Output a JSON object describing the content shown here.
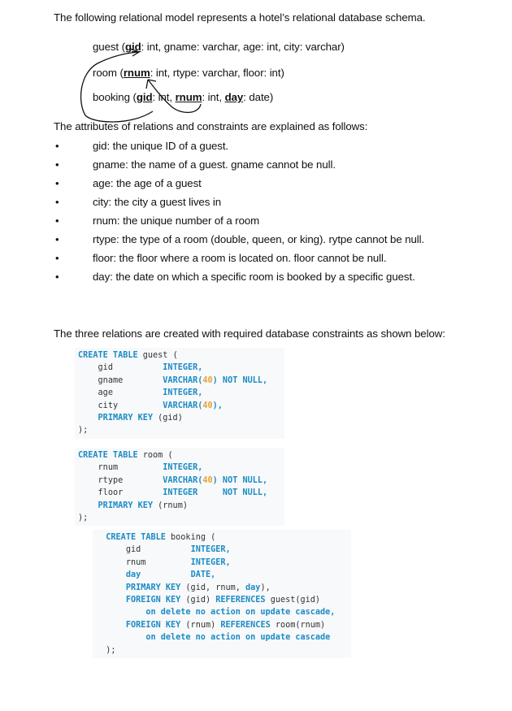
{
  "intro": "The following relational model represents a hotel’s relational database schema.",
  "schema": {
    "guest": {
      "name": "guest",
      "key": "gid",
      "rest": ": int, gname: varchar, age: int, city: varchar)"
    },
    "room": {
      "name": "room",
      "key": "rnum",
      "rest": ": int, rtype: varchar, floor: int)"
    },
    "booking": {
      "name": "booking",
      "key1": "gid",
      "mid1": ": int, ",
      "key2": "rnum",
      "mid2": ": int, ",
      "key3": "day",
      "rest": ": date)"
    }
  },
  "explain_heading": "The attributes of relations and constraints are explained as follows:",
  "attributes": [
    "gid: the unique ID of a guest.",
    "gname: the name of a guest. gname cannot be null.",
    "age: the age of a guest",
    "city: the city a guest lives in",
    "rnum: the unique number of a room",
    "rtype: the type of a room (double, queen, or king). rytpe cannot be null.",
    "floor: the floor where a room is located on. floor cannot be null.",
    "day: the date on which a specific room is booked by a specific guest."
  ],
  "bullet_glyph": "•",
  "relations_heading": "The three relations are created with required database constraints as shown below:",
  "code": {
    "guest": {
      "create": "CREATE TABLE",
      "table": "guest",
      "open": "(",
      "cols": [
        {
          "name": "gid",
          "type": "INTEGER",
          "num": "",
          "tail": "",
          "extra": ","
        },
        {
          "name": "gname",
          "type": "VARCHAR(",
          "num": "40",
          "tail": ")",
          "extra": " NOT NULL,"
        },
        {
          "name": "age",
          "type": "INTEGER",
          "num": "",
          "tail": "",
          "extra": ","
        },
        {
          "name": "city",
          "type": "VARCHAR(",
          "num": "40",
          "tail": ")",
          "extra": ","
        }
      ],
      "pk_kw": "PRIMARY KEY",
      "pk": "(gid)",
      "close": ");"
    },
    "room": {
      "create": "CREATE TABLE",
      "table": "room",
      "open": "(",
      "cols": [
        {
          "name": "rnum",
          "type": "INTEGER",
          "num": "",
          "tail": "",
          "extra": ","
        },
        {
          "name": "rtype",
          "type": "VARCHAR(",
          "num": "40",
          "tail": ")",
          "extra": " NOT NULL,"
        },
        {
          "name": "floor",
          "type": "INTEGER",
          "num": "",
          "tail": "",
          "extra": "     NOT NULL,"
        }
      ],
      "pk_kw": "PRIMARY KEY",
      "pk": "(rnum)",
      "close": ");"
    },
    "booking": {
      "create": "CREATE TABLE",
      "table": "booking",
      "open": "(",
      "cols": [
        {
          "name": "gid",
          "type": "INTEGER,"
        },
        {
          "name": "rnum",
          "type": "INTEGER,"
        },
        {
          "name": "day",
          "type": "DATE,"
        }
      ],
      "pk_kw": "PRIMARY KEY",
      "pk_a": "(gid, rnum, ",
      "pk_day": "day",
      "pk_b": "),",
      "fk1_kw": "FOREIGN KEY",
      "fk1_col": "(gid)",
      "fk1_ref": "REFERENCES",
      "fk1_target": "guest(gid)",
      "fk1_action": "on delete no action on update cascade,",
      "fk2_kw": "FOREIGN KEY",
      "fk2_col": "(rnum)",
      "fk2_ref": "REFERENCES",
      "fk2_target": "room(rnum)",
      "fk2_action": "on delete no action on update cascade",
      "close": ");"
    }
  }
}
